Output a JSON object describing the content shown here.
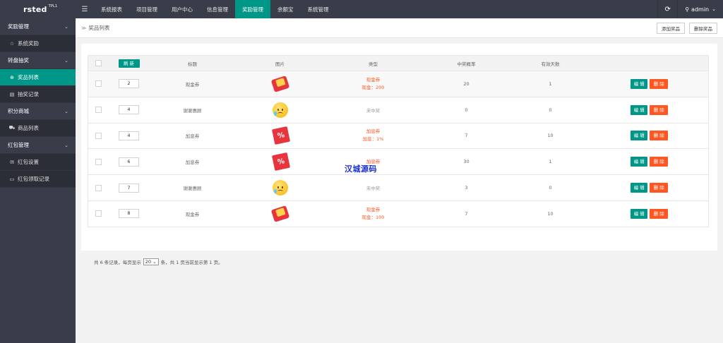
{
  "logo": {
    "name": "rsted",
    "sup": "TPL1"
  },
  "nav": [
    "系统报表",
    "项目管理",
    "用户中心",
    "信息管理",
    "奖励管理",
    "余额宝",
    "系统管理"
  ],
  "nav_active": 4,
  "user": {
    "name": "admin"
  },
  "icons": {
    "menu": "hamburger-icon",
    "refresh": "refresh-icon",
    "user": "user-icon"
  },
  "sidebar": {
    "groups": [
      {
        "label": "奖励管理",
        "items": [
          {
            "label": "系统奖励",
            "icon": "star-icon",
            "glyph": "☆"
          }
        ]
      },
      {
        "label": "转盘抽奖",
        "items": [
          {
            "label": "奖品列表",
            "icon": "plus-circle-icon",
            "glyph": "⊕"
          },
          {
            "label": "抽奖记录",
            "icon": "list-icon",
            "glyph": "▤"
          }
        ]
      },
      {
        "label": "积分商城",
        "items": [
          {
            "label": "商品列表",
            "icon": "cart-icon",
            "glyph": "⛟"
          }
        ]
      },
      {
        "label": "红包管理",
        "items": [
          {
            "label": "红包设置",
            "icon": "mail-icon",
            "glyph": "✉"
          },
          {
            "label": "红包领取记录",
            "icon": "card-icon",
            "glyph": "▭"
          }
        ]
      }
    ],
    "active_item": "奖品列表"
  },
  "breadcrumb": {
    "text": "奖品列表"
  },
  "actions": {
    "add": "添加奖品",
    "delete": "删除奖品"
  },
  "table": {
    "headers": {
      "refresh": "刷 新",
      "title": "标题",
      "image": "图片",
      "type": "类型",
      "prob": "中奖概率",
      "days": "有效天数"
    },
    "edit_label": "编 辑",
    "delete_label": "删 除",
    "rows": [
      {
        "sort": "2",
        "title": "现金券",
        "pic": "cash",
        "type": "现金券",
        "detail": "现金：200",
        "red": true,
        "prob": "20",
        "days": "1"
      },
      {
        "sort": "4",
        "title": "谢谢惠顾",
        "pic": "sad",
        "type": "未中奖",
        "detail": "",
        "red": false,
        "prob": "0",
        "days": "0"
      },
      {
        "sort": "4",
        "title": "加息券",
        "pic": "coupon",
        "type": "加息券",
        "detail": "加息：1%",
        "red": true,
        "prob": "7",
        "days": "10"
      },
      {
        "sort": "6",
        "title": "加息券",
        "pic": "coupon",
        "type": "加息券",
        "detail": "",
        "red": true,
        "prob": "30",
        "days": "1"
      },
      {
        "sort": "7",
        "title": "谢谢惠顾",
        "pic": "sad",
        "type": "未中奖",
        "detail": "",
        "red": false,
        "prob": "3",
        "days": "0"
      },
      {
        "sort": "8",
        "title": "现金券",
        "pic": "cash",
        "type": "现金券",
        "detail": "现金：100",
        "red": true,
        "prob": "7",
        "days": "10"
      }
    ]
  },
  "pager": {
    "before": "共 6 条记录，每页显示",
    "per_page": "20",
    "after": "条，共 1 页当前显示第 1 页。"
  },
  "watermark": "汉城源码",
  "colors": {
    "accent": "#009688",
    "danger": "#ff5722",
    "dark": "#393d49"
  }
}
